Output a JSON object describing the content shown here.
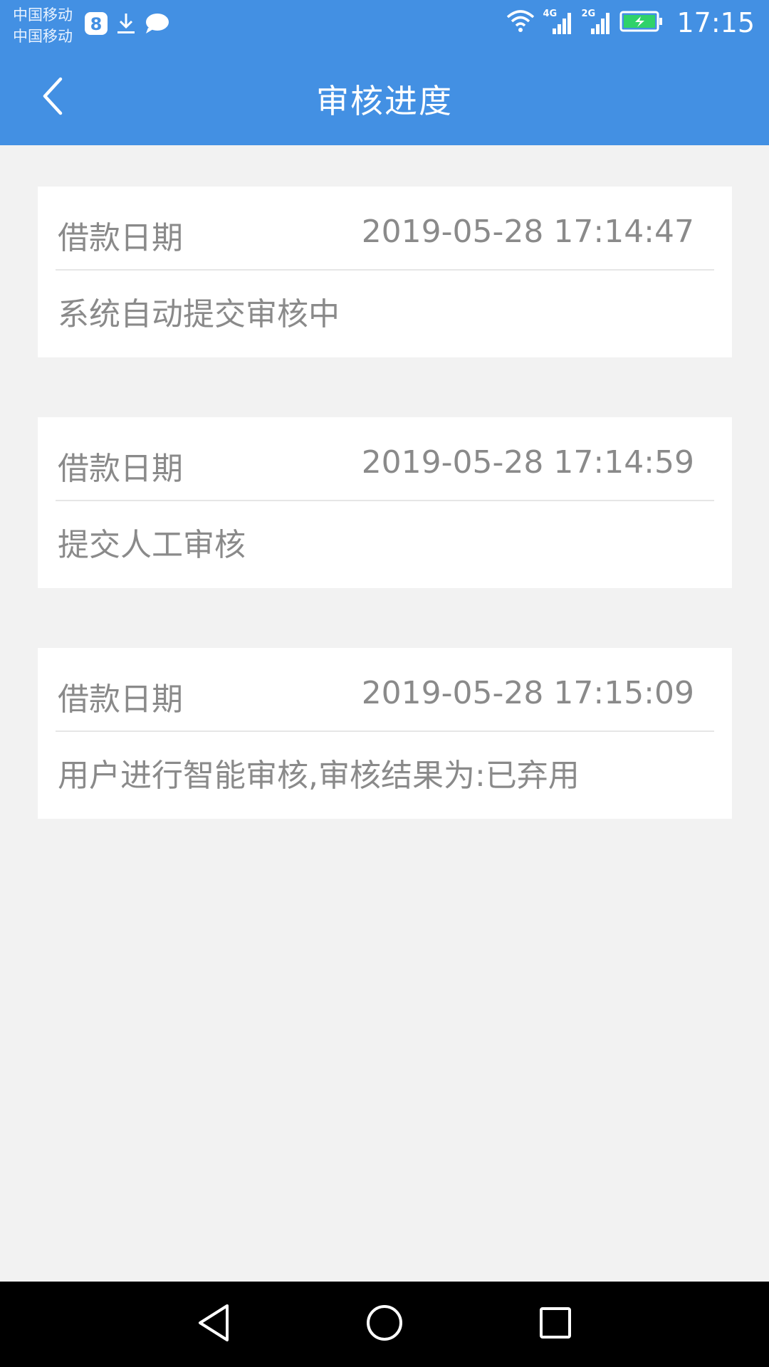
{
  "status_bar": {
    "carrier_1": "中国移动",
    "carrier_2": "中国移动",
    "network_1": "4G",
    "network_2": "2G",
    "time": "17:15"
  },
  "header": {
    "title": "审核进度"
  },
  "records": [
    {
      "label": "借款日期",
      "date": "2019-05-28 17:14:47",
      "description": "系统自动提交审核中"
    },
    {
      "label": "借款日期",
      "date": "2019-05-28 17:14:59",
      "description": "提交人工审核"
    },
    {
      "label": "借款日期",
      "date": "2019-05-28 17:15:09",
      "description": "用户进行智能审核,审核结果为:已弃用"
    }
  ],
  "colors": {
    "primary": "#4390e3",
    "background": "#f2f2f2",
    "text_muted": "#8a8a8a"
  }
}
